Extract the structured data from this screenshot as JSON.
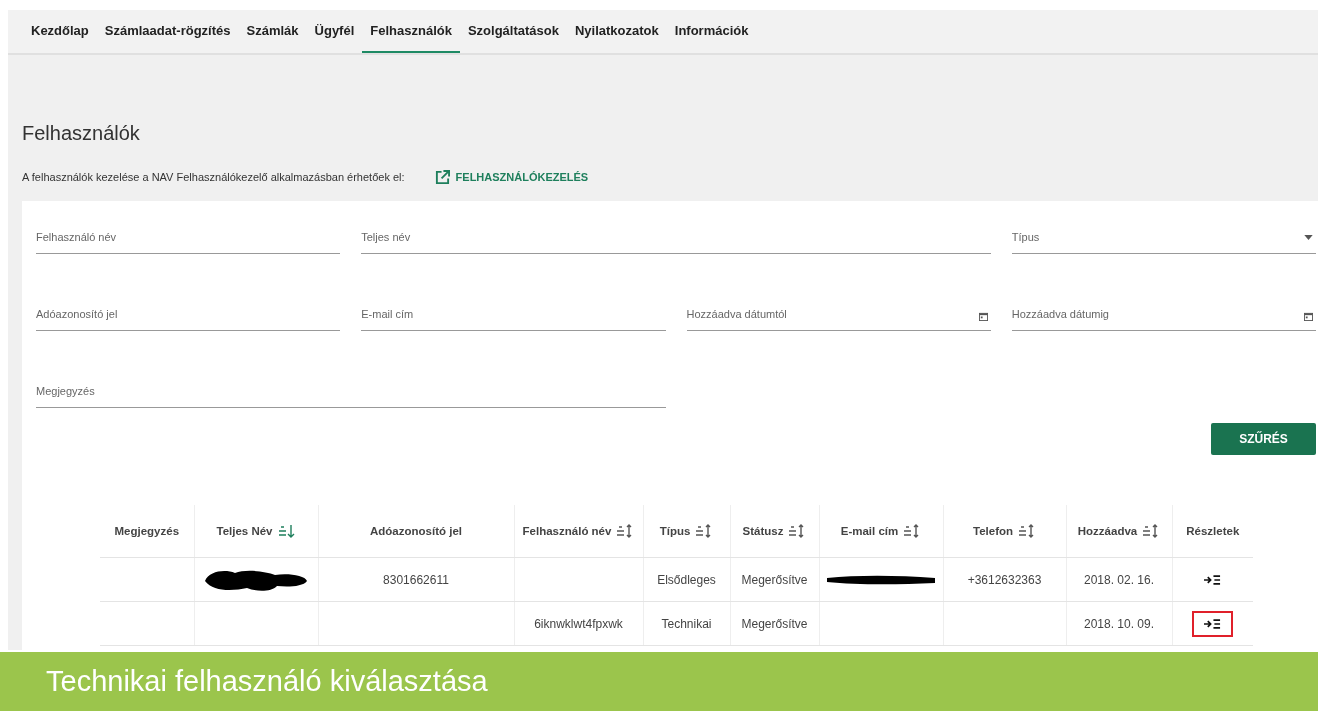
{
  "nav": {
    "tabs": [
      {
        "label": "Kezdőlap",
        "selected": false
      },
      {
        "label": "Számlaadat-rögzítés",
        "selected": false
      },
      {
        "label": "Számlák",
        "selected": false
      },
      {
        "label": "Ügyfél",
        "selected": false
      },
      {
        "label": "Felhasználók",
        "selected": true
      },
      {
        "label": "Szolgáltatások",
        "selected": false
      },
      {
        "label": "Nyilatkozatok",
        "selected": false
      },
      {
        "label": "Információk",
        "selected": false
      }
    ]
  },
  "page": {
    "title": "Felhasználók",
    "description": "A felhasználók kezelése a NAV Felhasználókezelő alkalmazásban érhetőek el:",
    "link": "FELHASZNÁLÓKEZELÉS"
  },
  "filter": {
    "fields": [
      {
        "placeholder": "Felhasználó név",
        "kind": "text"
      },
      {
        "placeholder": "Teljes név",
        "kind": "text"
      },
      {
        "placeholder": "Típus",
        "kind": "select"
      },
      {
        "placeholder": "Adóazonosító jel",
        "kind": "text"
      },
      {
        "placeholder": "E-mail cím",
        "kind": "text"
      },
      {
        "placeholder": "Hozzáadva dátumtól",
        "kind": "date"
      },
      {
        "placeholder": "Hozzáadva dátumig",
        "kind": "date"
      },
      {
        "placeholder": "Megjegyzés",
        "kind": "text"
      }
    ],
    "button": "SZŰRÉS"
  },
  "table": {
    "columns": [
      {
        "label": "Megjegyzés"
      },
      {
        "label": "Teljes Név",
        "sorted": true
      },
      {
        "label": "Adóazonosító jel"
      },
      {
        "label": "Felhasználó név",
        "sorted": false
      },
      {
        "label": "Típus",
        "sorted": false
      },
      {
        "label": "Státusz",
        "sorted": false
      },
      {
        "label": "E-mail cím",
        "sorted": false
      },
      {
        "label": "Telefon",
        "sorted": false
      },
      {
        "label": "Hozzáadva",
        "sorted": false
      },
      {
        "label": "Részletek"
      }
    ],
    "rows": [
      {
        "full_name_redacted": true,
        "tax_id": "8301662611",
        "type": "Elsődleges",
        "status": "Megerősítve",
        "email_redacted": true,
        "phone": "+3612632363",
        "added": "2018. 02. 16.",
        "details_highlighted": false
      },
      {
        "full_name_redacted": false,
        "username": "6iknwklwt4fpxwk",
        "type": "Technikai",
        "status": "Megerősítve",
        "email_redacted": false,
        "added": "2018. 10. 09.",
        "details_highlighted": true
      }
    ]
  },
  "caption": "Technikai felhasználó kiválasztása"
}
